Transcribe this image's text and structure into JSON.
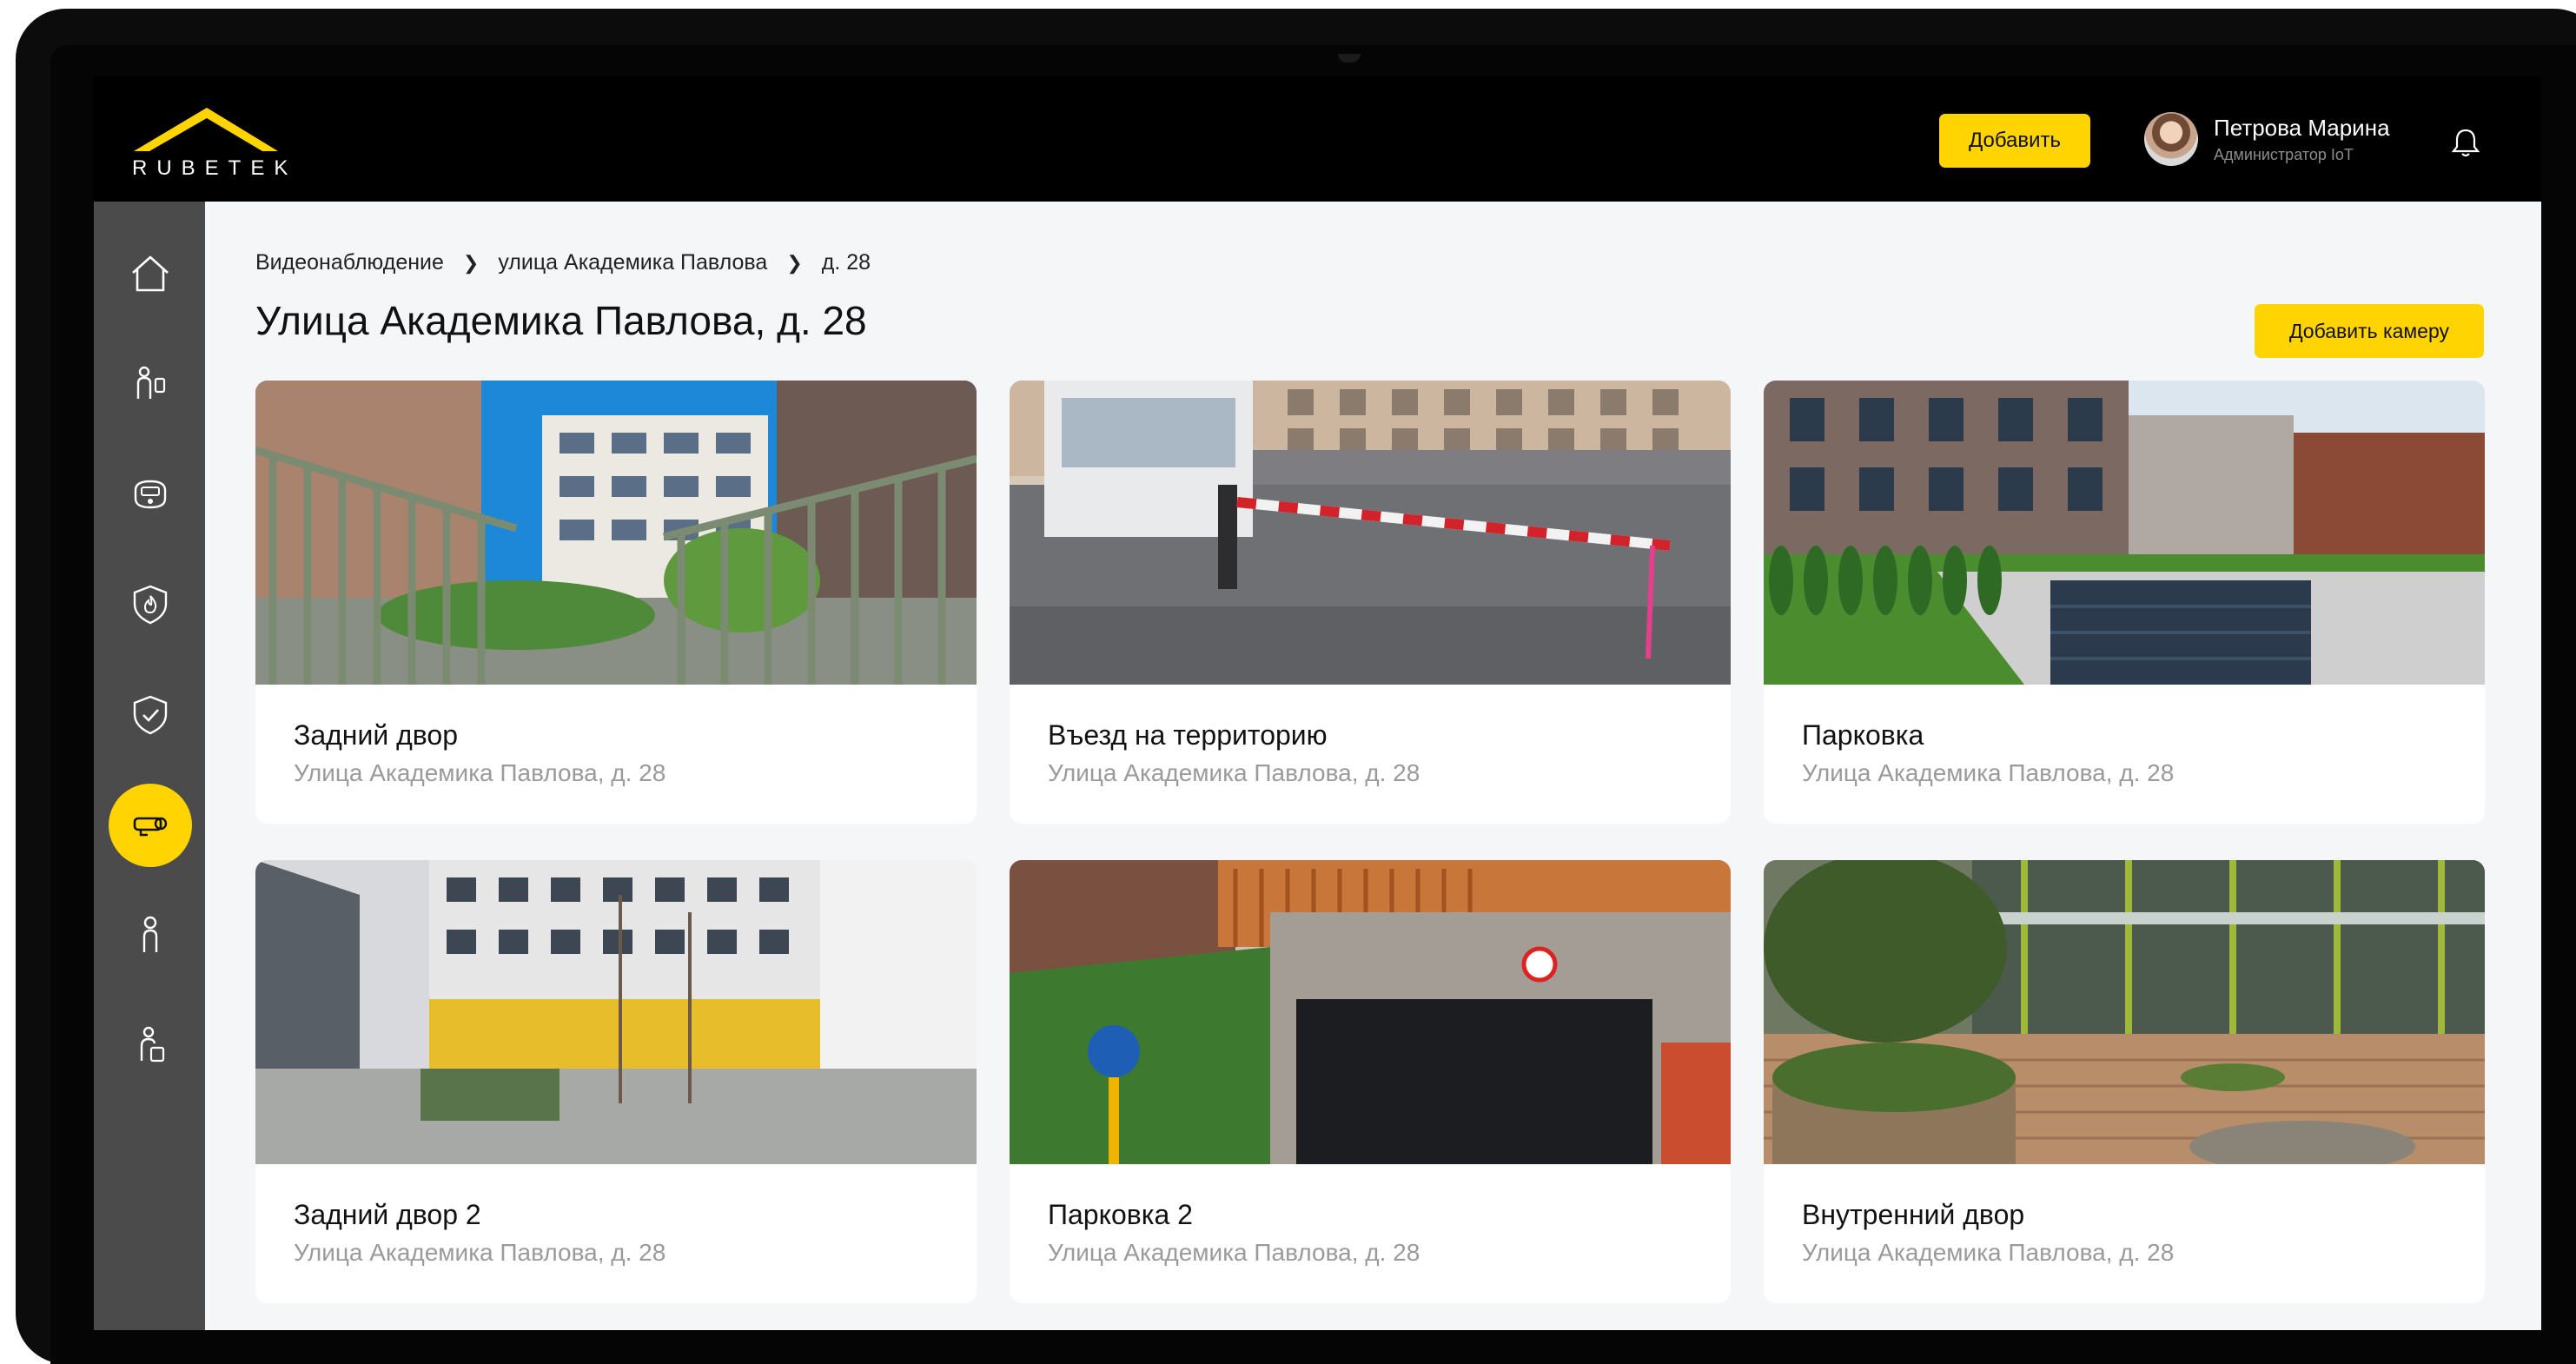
{
  "header": {
    "logo_text": "RUBETEK",
    "add_button": "Добавить",
    "user_name": "Петрова Марина",
    "user_role": "Администратор IoT"
  },
  "sidebar": {
    "items": [
      {
        "name": "home"
      },
      {
        "name": "intercom"
      },
      {
        "name": "meter"
      },
      {
        "name": "fire-safety"
      },
      {
        "name": "security"
      },
      {
        "name": "video",
        "active": true
      },
      {
        "name": "person"
      },
      {
        "name": "person-device"
      }
    ]
  },
  "breadcrumb": [
    "Видеонаблюдение",
    "улица Академика Павлова",
    "д. 28"
  ],
  "page": {
    "title": "Улица Академика Павлова, д. 28",
    "add_camera_button": "Добавить камеру"
  },
  "cameras": [
    {
      "title": "Задний двор",
      "address": "Улица Академика Павлова, д. 28"
    },
    {
      "title": "Въезд на территорию",
      "address": "Улица Академика Павлова, д. 28"
    },
    {
      "title": "Парковка",
      "address": "Улица Академика Павлова, д. 28"
    },
    {
      "title": "Задний двор 2",
      "address": "Улица Академика Павлова, д. 28"
    },
    {
      "title": "Парковка 2",
      "address": "Улица Академика Павлова, д. 28"
    },
    {
      "title": "Внутренний двор",
      "address": "Улица Академика Павлова, д. 28"
    }
  ],
  "colors": {
    "accent": "#ffd400",
    "sidebar": "#4b4b4c",
    "background": "#f5f6f8"
  }
}
